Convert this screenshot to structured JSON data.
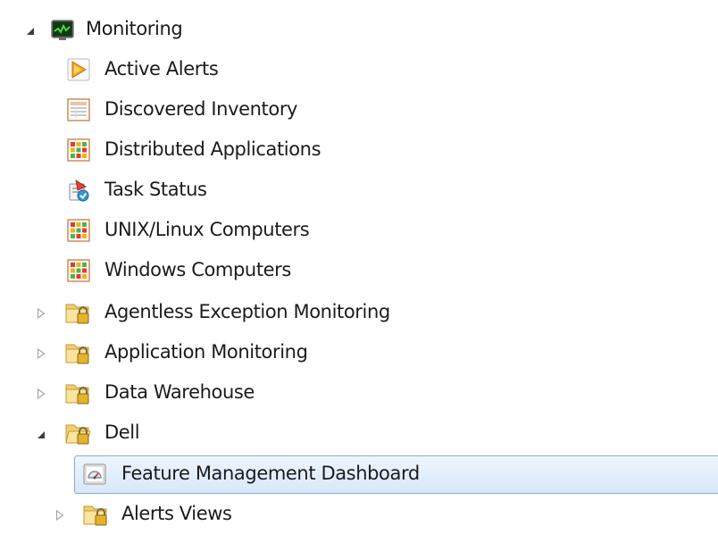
{
  "tree": {
    "root": {
      "label": "Monitoring",
      "expanded": true,
      "icon": "monitor-icon"
    },
    "items": [
      {
        "label": "Active Alerts",
        "icon": "alert-icon"
      },
      {
        "label": "Discovered Inventory",
        "icon": "inventory-grid-icon"
      },
      {
        "label": "Distributed Applications",
        "icon": "state-grid-icon"
      },
      {
        "label": "Task Status",
        "icon": "task-status-icon"
      },
      {
        "label": "UNIX/Linux Computers",
        "icon": "state-grid-icon"
      },
      {
        "label": "Windows Computers",
        "icon": "state-grid-icon"
      },
      {
        "label": "Agentless Exception Monitoring",
        "icon": "locked-folder-icon",
        "expanded": false
      },
      {
        "label": "Application Monitoring",
        "icon": "locked-folder-icon",
        "expanded": false
      },
      {
        "label": "Data Warehouse",
        "icon": "locked-folder-icon",
        "expanded": false
      },
      {
        "label": "Dell",
        "icon": "open-locked-folder-icon",
        "expanded": true
      }
    ],
    "dell_children": [
      {
        "label": "Feature Management Dashboard",
        "icon": "dashboard-icon",
        "selected": true
      },
      {
        "label": "Alerts Views",
        "icon": "locked-folder-icon",
        "expanded": false
      }
    ]
  },
  "colors": {
    "selection_border": "#84acdd",
    "selection_fill": "#d9e8fa",
    "expander": "#a6a6a6",
    "expanded_arrow": "#3c3c3c"
  }
}
